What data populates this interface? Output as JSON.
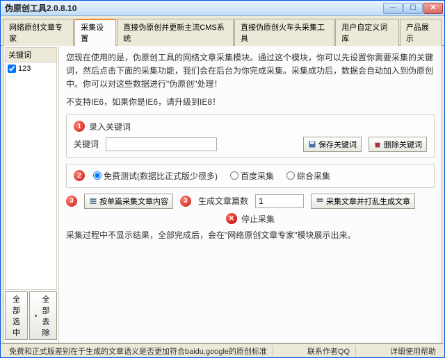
{
  "window": {
    "title": "伪原创工具2.0.8.10"
  },
  "tabs": [
    {
      "label": "网络原创文章专家"
    },
    {
      "label": "采集设置",
      "active": true
    },
    {
      "label": "直接伪原创并更新主流CMS系统"
    },
    {
      "label": "直接伪原创火车头采集工具"
    },
    {
      "label": "用户自定义词库"
    },
    {
      "label": "产品展示"
    }
  ],
  "left": {
    "header": "关键词",
    "items": [
      {
        "label": "123",
        "checked": true
      }
    ],
    "select_all": "全部选中",
    "remove_all": "全部去除"
  },
  "intro": "您现在使用的是，伪原创工具的网络文章采集模块。通过这个模块，你可以先设置你需要采集的关键词，然后点击下面的采集功能，我们会在后台为你完成采集。采集成功后，数据会自动加入到伪原创中。你可以对这些数据进行\"伪原创\"处理！",
  "intro2": "不支持IE6，如果你是IE6，请升级到IE8！",
  "sec1": {
    "badge": "1",
    "title": "录入关键词",
    "label": "关键词",
    "placeholder": "",
    "save_btn": "保存关键词",
    "del_btn": "删除关键词"
  },
  "sec2": {
    "badge": "2",
    "r1": "免费测试(数据比正式版少很多)",
    "r2": "百度采集",
    "r3": "综合采集"
  },
  "sec3": {
    "badge3": "3",
    "btn3": "按单篇采集文章内容",
    "badge4": "3",
    "label4": "生成文章篇数",
    "value4": "1",
    "btn4": "采集文章并打乱生成文章"
  },
  "stop": {
    "label": "停止采集"
  },
  "note": "采集过程中不显示结果，全部完成后，会在\"网络原创文章专家\"模块展示出来。",
  "status": {
    "left": "免费和正式版差别在于生成的文章语义是否更加符合baidu,google的原创标准",
    "mid": "联系作者QQ",
    "right": "详细使用帮助"
  }
}
